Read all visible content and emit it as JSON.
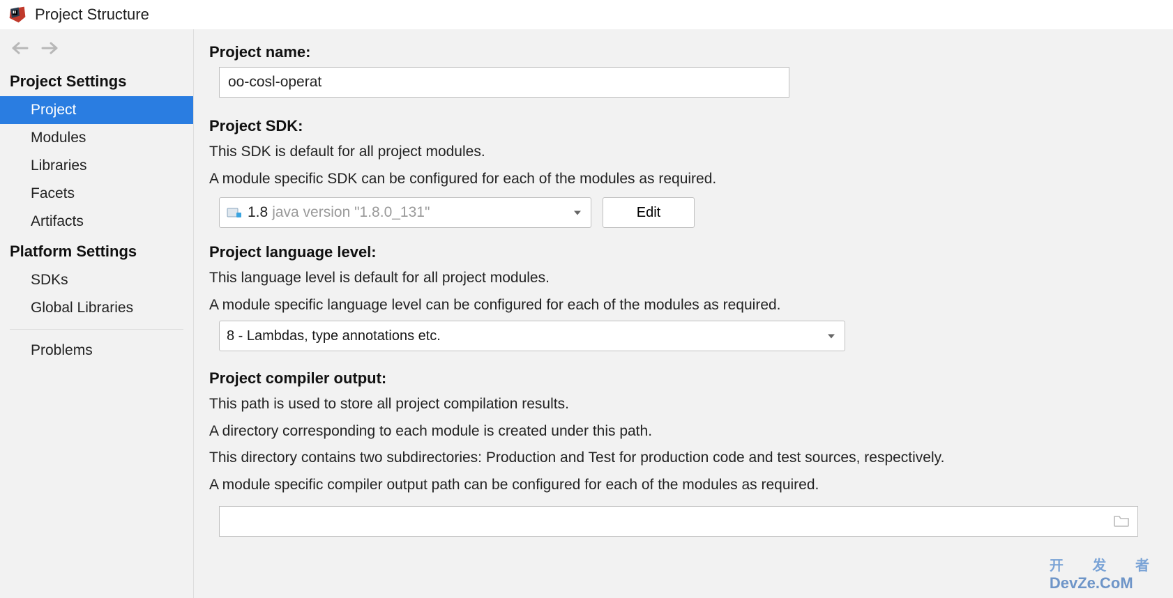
{
  "window": {
    "title": "Project Structure"
  },
  "sidebar": {
    "project_settings_header": "Project Settings",
    "platform_settings_header": "Platform Settings",
    "items_project_settings": [
      {
        "label": "Project",
        "selected": true
      },
      {
        "label": "Modules"
      },
      {
        "label": "Libraries"
      },
      {
        "label": "Facets"
      },
      {
        "label": "Artifacts"
      }
    ],
    "items_platform_settings": [
      {
        "label": "SDKs"
      },
      {
        "label": "Global Libraries"
      }
    ],
    "problems_label": "Problems"
  },
  "main": {
    "project_name_label": "Project name:",
    "project_name_value": "oo-cosl-operat",
    "project_sdk_label": "Project SDK:",
    "sdk_help_1": "This SDK is default for all project modules.",
    "sdk_help_2": "A module specific SDK can be configured for each of the modules as required.",
    "sdk_selected_name": "1.8",
    "sdk_selected_version": "java version \"1.8.0_131\"",
    "edit_button": "Edit",
    "language_level_label": "Project language level:",
    "lang_help_1": "This language level is default for all project modules.",
    "lang_help_2": "A module specific language level can be configured for each of the modules as required.",
    "language_level_value": "8 - Lambdas, type annotations etc.",
    "compiler_output_label": "Project compiler output:",
    "compiler_help_1": "This path is used to store all project compilation results.",
    "compiler_help_2": "A directory corresponding to each module is created under this path.",
    "compiler_help_3": "This directory contains two subdirectories: Production and Test for production code and test sources, respectively.",
    "compiler_help_4": "A module specific compiler output path can be configured for each of the modules as required.",
    "compiler_output_value": ""
  },
  "watermark": {
    "cn": "开 发 者",
    "en": "DevZe.CoM"
  }
}
